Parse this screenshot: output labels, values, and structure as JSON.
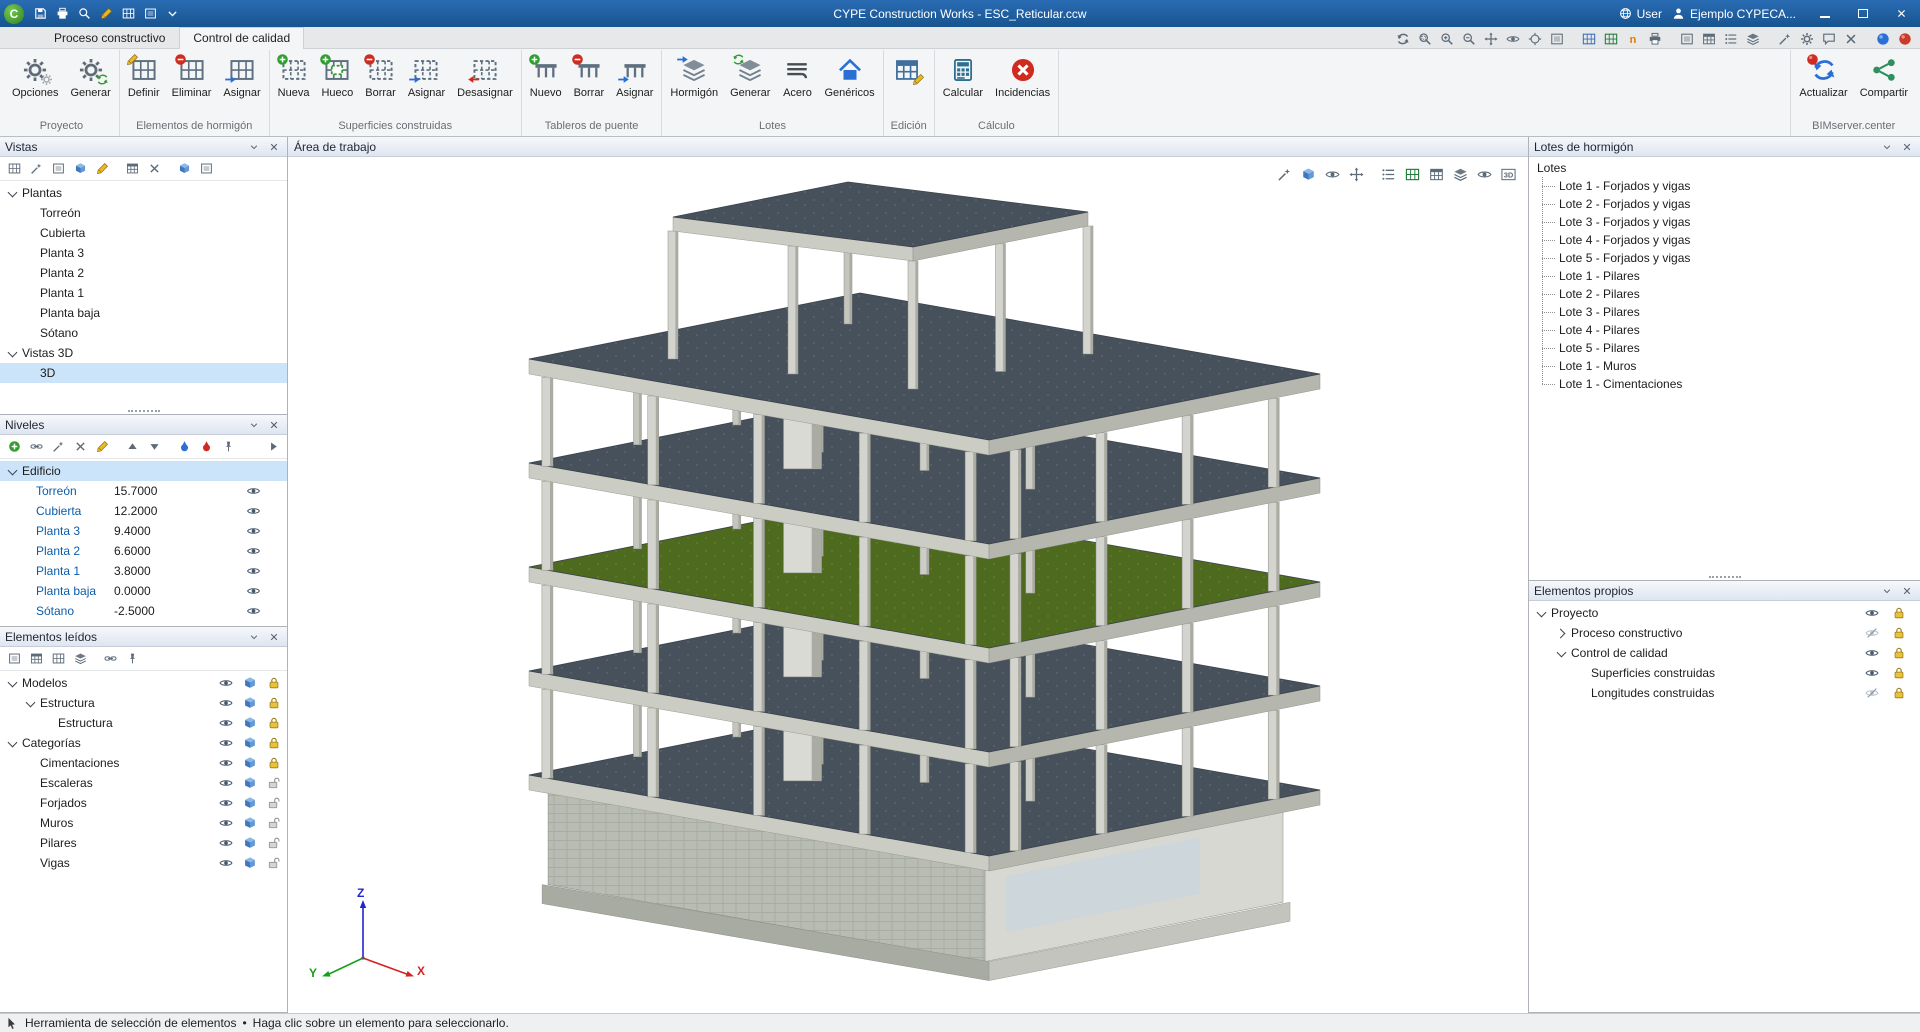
{
  "window": {
    "title": "CYPE Construction Works - ESC_Reticular.ccw",
    "user_label": "User",
    "project_label": "Ejemplo CYPECA..."
  },
  "quick_access": [
    {
      "name": "save-icon",
      "sym": "disk"
    },
    {
      "name": "print-icon",
      "sym": "printer"
    },
    {
      "name": "zoom-icon",
      "sym": "mag"
    },
    {
      "name": "edit-icon",
      "sym": "pencil"
    },
    {
      "name": "drawing-icon",
      "sym": "grid"
    },
    {
      "name": "capture-icon",
      "sym": "frame"
    },
    {
      "name": "quick-access-options-icon",
      "sym": "chevd"
    }
  ],
  "tabs": [
    {
      "label": "Proceso constructivo",
      "active": false
    },
    {
      "label": "Control de calidad",
      "active": true
    }
  ],
  "view_tools": [
    {
      "name": "orbit-view-icon",
      "sym": "sync"
    },
    {
      "name": "zoom-window-icon",
      "sym": "magwin"
    },
    {
      "name": "zoom-in-icon",
      "sym": "magplus"
    },
    {
      "name": "zoom-out-icon",
      "sym": "magminus"
    },
    {
      "name": "pan-icon",
      "sym": "move"
    },
    {
      "name": "previous-view-icon",
      "sym": "eye"
    },
    {
      "name": "center-view-icon",
      "sym": "target"
    },
    {
      "name": "fit-view-icon",
      "sym": "frame"
    },
    {
      "name": "export-dxf-icon",
      "sym": "grid",
      "color": "#3a6db8",
      "gap": true
    },
    {
      "name": "export-spreadsheet-icon",
      "sym": "grid",
      "color": "#217a3c"
    },
    {
      "name": "export-document-icon",
      "sym": "ntext",
      "color": "#e07b00"
    },
    {
      "name": "print-view-icon",
      "sym": "printer"
    },
    {
      "name": "window-layout-1-icon",
      "sym": "frame",
      "gap": true
    },
    {
      "name": "window-layout-2-icon",
      "sym": "table"
    },
    {
      "name": "window-layout-3-icon",
      "sym": "list"
    },
    {
      "name": "window-layout-4-icon",
      "sym": "layers"
    },
    {
      "name": "measure-icon",
      "sym": "wand",
      "gap": true
    },
    {
      "name": "configuration-icon",
      "sym": "gear"
    },
    {
      "name": "comments-icon",
      "sym": "bubble"
    },
    {
      "name": "close-view-icon",
      "sym": "close"
    },
    {
      "name": "bimserver-web-icon",
      "sym": "sphere",
      "color": "#2a6fd6",
      "gap": true
    },
    {
      "name": "support-icon",
      "sym": "sphere",
      "color": "#cc3a2a"
    }
  ],
  "ribbon": {
    "groups": [
      {
        "label": "Proyecto",
        "buttons": [
          {
            "label": "Opciones",
            "icon": "gears"
          },
          {
            "label": "Generar",
            "icon": "gear-generate"
          }
        ]
      },
      {
        "label": "Elementos de hormigón",
        "buttons": [
          {
            "label": "Definir",
            "icon": "grid-pencil"
          },
          {
            "label": "Eliminar",
            "icon": "grid-delete"
          },
          {
            "label": "Asignar",
            "icon": "grid-assign"
          }
        ]
      },
      {
        "label": "Superficies construidas",
        "buttons": [
          {
            "label": "Nueva",
            "icon": "surface-new"
          },
          {
            "label": "Hueco",
            "icon": "surface-hole"
          },
          {
            "label": "Borrar",
            "icon": "surface-delete"
          },
          {
            "label": "Asignar",
            "icon": "surface-assign"
          },
          {
            "label": "Desasignar",
            "icon": "surface-unassign"
          }
        ]
      },
      {
        "label": "Tableros de puente",
        "buttons": [
          {
            "label": "Nuevo",
            "icon": "deck-new"
          },
          {
            "label": "Borrar",
            "icon": "deck-delete"
          },
          {
            "label": "Asignar",
            "icon": "deck-assign"
          }
        ]
      },
      {
        "label": "Lotes",
        "buttons": [
          {
            "label": "Hormigón",
            "icon": "lot-concrete"
          },
          {
            "label": "Generar",
            "icon": "lot-generate"
          },
          {
            "label": "Acero",
            "icon": "lot-steel"
          },
          {
            "label": "Genéricos",
            "icon": "lot-generic"
          }
        ]
      },
      {
        "label": "Edición",
        "buttons": [
          {
            "label": "",
            "icon": "edit-table"
          }
        ]
      },
      {
        "label": "Cálculo",
        "buttons": [
          {
            "label": "Calcular",
            "icon": "calculator"
          },
          {
            "label": "Incidencias",
            "icon": "incidents"
          }
        ]
      }
    ],
    "bim_group": {
      "label": "BIMserver.center",
      "buttons": [
        {
          "label": "Actualizar",
          "icon": "bim-update"
        },
        {
          "label": "Compartir",
          "icon": "bim-share"
        }
      ]
    }
  },
  "panels": {
    "vistas": {
      "title": "Vistas",
      "tools": [
        {
          "name": "new-plan-view-icon",
          "sym": "grid"
        },
        {
          "name": "new-section-view-icon",
          "sym": "wand"
        },
        {
          "name": "new-elevation-view-icon",
          "sym": "frame"
        },
        {
          "name": "new-3d-view-icon",
          "sym": "cube"
        },
        {
          "name": "edit-view-icon",
          "sym": "pencil"
        },
        {
          "name": "duplicate-view-icon",
          "sym": "table",
          "gap": true
        },
        {
          "name": "delete-view-icon",
          "sym": "close"
        },
        {
          "name": "solid-mode-icon",
          "sym": "cube",
          "gap": true
        },
        {
          "name": "wireframe-mode-icon",
          "sym": "frame"
        }
      ],
      "tree": [
        {
          "label": "Plantas",
          "level": 0,
          "expanded": true
        },
        {
          "label": "Torreón",
          "level": 1
        },
        {
          "label": "Cubierta",
          "level": 1
        },
        {
          "label": "Planta 3",
          "level": 1
        },
        {
          "label": "Planta 2",
          "level": 1
        },
        {
          "label": "Planta 1",
          "level": 1
        },
        {
          "label": "Planta baja",
          "level": 1
        },
        {
          "label": "Sótano",
          "level": 1
        },
        {
          "label": "Vistas 3D",
          "level": 0,
          "expanded": true
        },
        {
          "label": "3D",
          "level": 1,
          "selected": true
        }
      ]
    },
    "niveles": {
      "title": "Niveles",
      "tools": [
        {
          "name": "add-level-icon",
          "sym": "plusc"
        },
        {
          "name": "link-levels-icon",
          "sym": "chain"
        },
        {
          "name": "match-levels-icon",
          "sym": "wand"
        },
        {
          "name": "delete-level-icon",
          "sym": "close"
        },
        {
          "name": "edit-level-icon",
          "sym": "pencil"
        },
        {
          "name": "move-level-up-icon",
          "sym": "triup",
          "gap": true
        },
        {
          "name": "move-level-down-icon",
          "sym": "tridown"
        },
        {
          "name": "highlight-blue-icon",
          "sym": "drop",
          "color": "#2a6fd6",
          "gap": true
        },
        {
          "name": "highlight-red-icon",
          "sym": "drop",
          "color": "#cf2b20"
        },
        {
          "name": "pin-levels-icon",
          "sym": "pin"
        },
        {
          "name": "panel-overflow-icon",
          "sym": "trir",
          "right": true
        }
      ],
      "root": {
        "label": "Edificio"
      },
      "levels": [
        {
          "name": "Torreón",
          "value": "15.7000",
          "visible": true
        },
        {
          "name": "Cubierta",
          "value": "12.2000",
          "visible": true
        },
        {
          "name": "Planta 3",
          "value": "9.4000",
          "visible": true
        },
        {
          "name": "Planta 2",
          "value": "6.6000",
          "visible": true
        },
        {
          "name": "Planta 1",
          "value": "3.8000",
          "visible": true
        },
        {
          "name": "Planta baja",
          "value": "0.0000",
          "visible": true
        },
        {
          "name": "Sótano",
          "value": "-2.5000",
          "visible": true
        }
      ]
    },
    "elementos_leidos": {
      "title": "Elementos leídos",
      "tools": [
        {
          "name": "tile-views-icon",
          "sym": "frame"
        },
        {
          "name": "list-views-icon",
          "sym": "table"
        },
        {
          "name": "grid-views-icon",
          "sym": "grid"
        },
        {
          "name": "layer-views-icon",
          "sym": "layers"
        },
        {
          "name": "link-elements-icon",
          "sym": "chain",
          "gap": true
        },
        {
          "name": "pin-panel-icon",
          "sym": "pin"
        }
      ],
      "tree": [
        {
          "label": "Modelos",
          "level": 0,
          "expanded": true,
          "visible": true,
          "locked": true
        },
        {
          "label": "Estructura",
          "level": 1,
          "expanded": true,
          "visible": true,
          "locked": true
        },
        {
          "label": "Estructura",
          "level": 2,
          "visible": true,
          "locked": true
        },
        {
          "label": "Categorías",
          "level": 0,
          "expanded": true,
          "visible": true,
          "locked": true
        },
        {
          "label": "Cimentaciones",
          "level": 1,
          "visible": true,
          "locked": true
        },
        {
          "label": "Escaleras",
          "level": 1,
          "visible": true,
          "locked": false
        },
        {
          "label": "Forjados",
          "level": 1,
          "visible": true,
          "locked": false
        },
        {
          "label": "Muros",
          "level": 1,
          "visible": true,
          "locked": false
        },
        {
          "label": "Pilares",
          "level": 1,
          "visible": true,
          "locked": false
        },
        {
          "label": "Vigas",
          "level": 1,
          "visible": true,
          "locked": false
        }
      ]
    },
    "lotes": {
      "title": "Lotes de hormigón",
      "root": "Lotes",
      "items": [
        "Lote 1 - Forjados y vigas",
        "Lote 2 - Forjados y vigas",
        "Lote 3 - Forjados y vigas",
        "Lote 4 - Forjados y vigas",
        "Lote 5 - Forjados y vigas",
        "Lote 1 - Pilares",
        "Lote 2 - Pilares",
        "Lote 3 - Pilares",
        "Lote 4 - Pilares",
        "Lote 5 - Pilares",
        "Lote 1 - Muros",
        "Lote 1 - Cimentaciones"
      ]
    },
    "elementos_propios": {
      "title": "Elementos propios",
      "tree": [
        {
          "label": "Proyecto",
          "level": 0,
          "expanded": true,
          "visible": true,
          "locked": true
        },
        {
          "label": "Proceso constructivo",
          "level": 1,
          "collapsed": true,
          "visible": false,
          "locked": true
        },
        {
          "label": "Control de calidad",
          "level": 1,
          "expanded": true,
          "visible": true,
          "locked": true
        },
        {
          "label": "Superficies construidas",
          "level": 2,
          "visible": true,
          "locked": true
        },
        {
          "label": "Longitudes construidas",
          "level": 2,
          "visible": false,
          "locked": true
        }
      ]
    }
  },
  "workspace": {
    "title": "Área de trabajo",
    "tools": [
      {
        "name": "measure-tool-icon",
        "sym": "wand"
      },
      {
        "name": "section-box-icon",
        "sym": "cube"
      },
      {
        "name": "visibility-options-icon",
        "sym": "eye"
      },
      {
        "name": "orbit-tool-icon",
        "sym": "move"
      },
      {
        "name": "report-icon",
        "sym": "list",
        "gap": true
      },
      {
        "name": "export-table-icon",
        "sym": "grid",
        "color": "#217a3c"
      },
      {
        "name": "tables-icon",
        "sym": "table"
      },
      {
        "name": "layers-icon",
        "sym": "layers"
      },
      {
        "name": "hide-elements-icon",
        "sym": "eye"
      },
      {
        "name": "view-3d-icon",
        "sym": "d3text"
      }
    ],
    "axis": {
      "x": "X",
      "y": "Y",
      "z": "Z"
    }
  },
  "statusbar": {
    "tool": "Herramienta de selección de elementos",
    "separator": "•",
    "hint": "Haga clic sobre un elemento para seleccionarlo."
  }
}
